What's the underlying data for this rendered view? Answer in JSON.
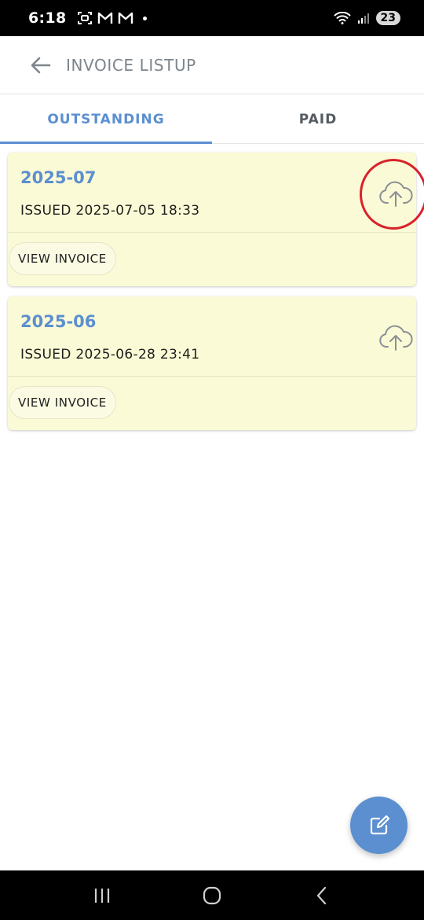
{
  "status_bar": {
    "time": "6:18",
    "battery_level": "23"
  },
  "app_bar": {
    "title": "INVOICE LISTUP"
  },
  "tabs": [
    {
      "label": "OUTSTANDING",
      "active": true
    },
    {
      "label": "PAID",
      "active": false
    }
  ],
  "invoices": [
    {
      "period": "2025-07",
      "issued": "ISSUED 2025-07-05 18:33",
      "action_label": "VIEW INVOICE",
      "highlighted": true
    },
    {
      "period": "2025-06",
      "issued": "ISSUED 2025-06-28 23:41",
      "action_label": "VIEW INVOICE",
      "highlighted": false
    }
  ],
  "colors": {
    "accent": "#5b8fd0",
    "card_background": "#fafad6",
    "highlight_ring": "#d8222a"
  },
  "icons": {
    "back": "arrow-left-icon",
    "upload": "cloud-upload-icon",
    "fab": "edit-icon"
  }
}
